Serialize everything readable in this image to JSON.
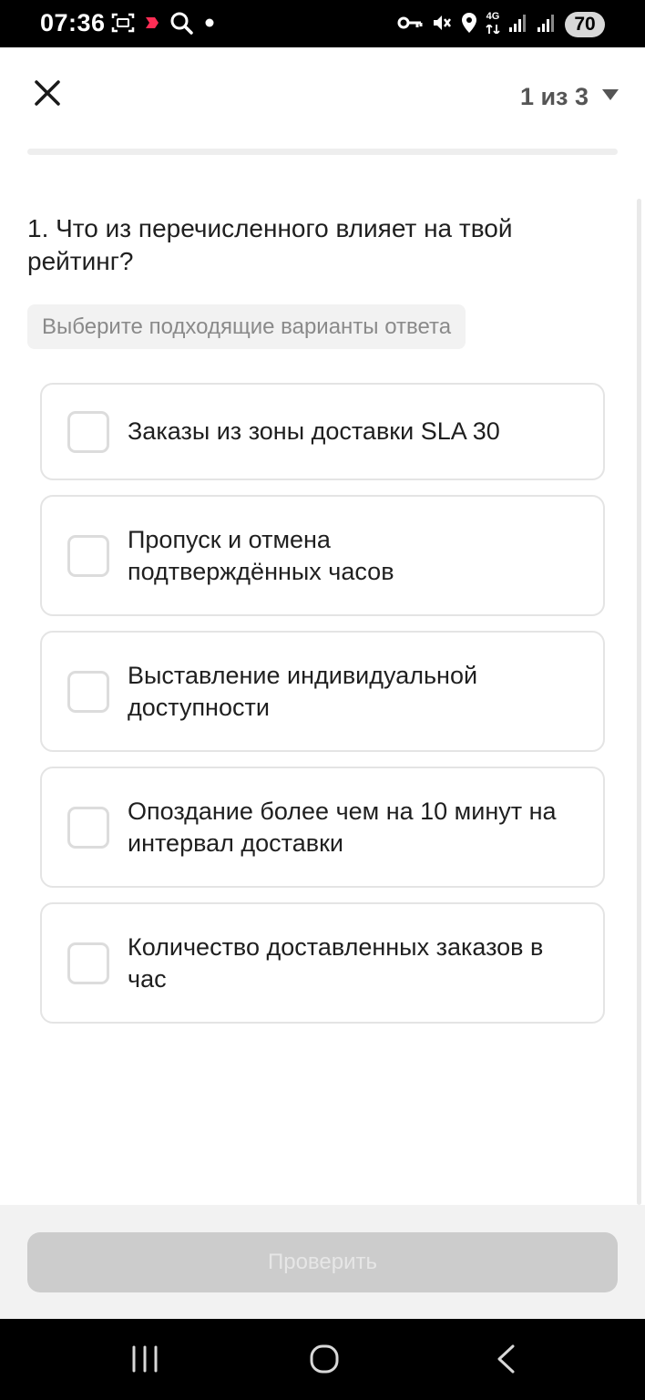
{
  "status_bar": {
    "time": "07:36",
    "battery": "70",
    "network_type": "4G",
    "left_icons": [
      "screenshot-icon",
      "app-notification-icon",
      "search-icon",
      "dot-icon"
    ],
    "right_icons": [
      "key-icon",
      "mute-icon",
      "location-icon",
      "network-4g-icon",
      "signal-icon",
      "signal-icon",
      "battery-icon"
    ]
  },
  "header": {
    "close_icon": "close-icon",
    "page_indicator": "1 из 3",
    "dropdown_icon": "triangle-down-icon"
  },
  "question": {
    "title": "1. Что из перечисленного влияет на твой рейтинг?",
    "hint": "Выберите подходящие варианты ответа"
  },
  "options": [
    {
      "label": "Заказы из зоны доставки SLA 30",
      "checked": false
    },
    {
      "label": "Пропуск и отмена подтверждённых часов",
      "checked": false
    },
    {
      "label": "Выставление индивидуальной доступности",
      "checked": false
    },
    {
      "label": "Опоздание более чем на 10 минут на интервал доставки",
      "checked": false
    },
    {
      "label": "Количество доставленных заказов в час",
      "checked": false
    }
  ],
  "footer": {
    "check_button": "Проверить",
    "check_button_enabled": false
  },
  "colors": {
    "text": "#1f1f1f",
    "hint_text": "#8a8a8a",
    "disabled_button": "#cccccc",
    "border": "#e4e4e4"
  }
}
